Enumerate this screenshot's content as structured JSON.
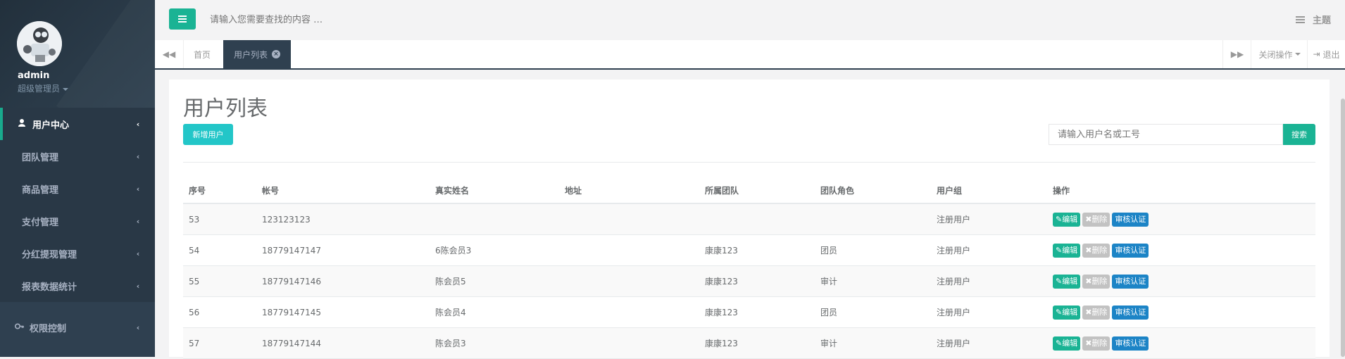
{
  "sidebar": {
    "username": "admin",
    "role": "超级管理员",
    "items": [
      {
        "label": "用户中心",
        "active": true,
        "icon": "user-icon"
      },
      {
        "label": "团队管理",
        "active": false
      },
      {
        "label": "商品管理",
        "active": false
      },
      {
        "label": "支付管理",
        "active": false
      },
      {
        "label": "分红提现管理",
        "active": false
      },
      {
        "label": "报表数据统计",
        "active": false
      },
      {
        "label": "权限控制",
        "active": false,
        "icon": "key-icon"
      }
    ]
  },
  "topbar": {
    "search_placeholder": "请输入您需要查找的内容 …",
    "theme_label": "主题"
  },
  "tabs": {
    "home": "首页",
    "current": "用户列表",
    "close_ops": "关闭操作",
    "logout": "退出"
  },
  "main": {
    "title": "用户列表",
    "add_button": "新增用户",
    "search_placeholder": "请输入用户名或工号",
    "search_button": "搜索",
    "columns": [
      "序号",
      "帐号",
      "真实姓名",
      "地址",
      "所属团队",
      "团队角色",
      "用户组",
      "操作"
    ],
    "actions": {
      "edit": "编辑",
      "delete": "删除",
      "audit": "审核认证"
    },
    "rows": [
      {
        "id": "53",
        "account": "123123123",
        "name": "",
        "address": "",
        "team": "",
        "team_role": "",
        "group": "注册用户"
      },
      {
        "id": "54",
        "account": "18779147147",
        "name": "6陈会员3",
        "address": "",
        "team": "康康123",
        "team_role": "团员",
        "group": "注册用户"
      },
      {
        "id": "55",
        "account": "18779147146",
        "name": "陈会员5",
        "address": "",
        "team": "康康123",
        "team_role": "审计",
        "group": "注册用户"
      },
      {
        "id": "56",
        "account": "18779147145",
        "name": "陈会员4",
        "address": "",
        "team": "康康123",
        "team_role": "团员",
        "group": "注册用户"
      },
      {
        "id": "57",
        "account": "18779147144",
        "name": "陈会员3",
        "address": "",
        "team": "康康123",
        "team_role": "审计",
        "group": "注册用户"
      }
    ]
  },
  "colors": {
    "sidebar_bg": "#2f4050",
    "primary": "#1ab394",
    "info": "#23c6c8",
    "audit": "#1c84c6"
  }
}
